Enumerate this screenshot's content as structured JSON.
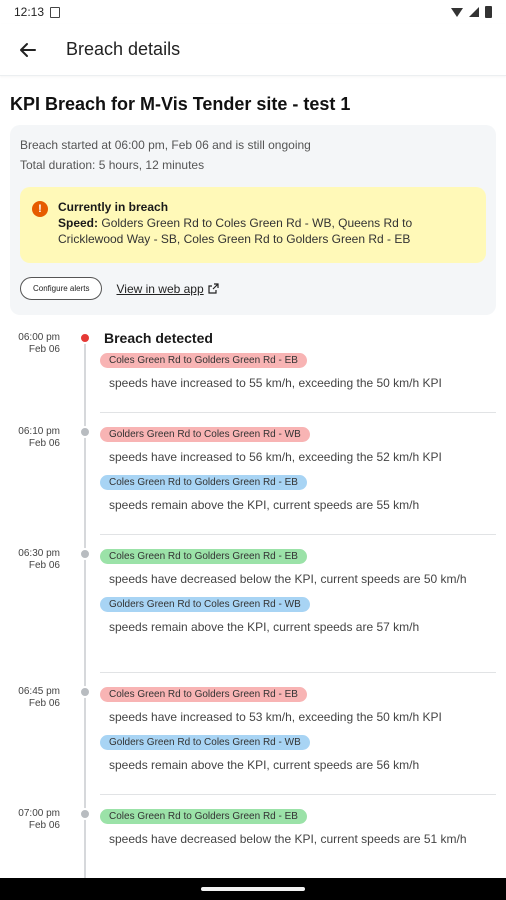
{
  "status_bar": {
    "time": "12:13"
  },
  "app_bar": {
    "title": "Breach details"
  },
  "page": {
    "title": "KPI Breach for M-Vis Tender site - test 1"
  },
  "summary": {
    "started": "Breach started at 06:00 pm, Feb 06 and is still ongoing",
    "duration": "Total duration: 5 hours, 12 minutes",
    "alert_title": "Currently in breach",
    "alert_prefix": "Speed:",
    "alert_text": "Golders Green Rd to Coles Green Rd - WB, Queens Rd to Cricklewood Way - SB, Coles Green Rd to Golders Green Rd - EB",
    "configure_label": "Configure alerts",
    "web_link_label": "View in web app"
  },
  "timeline": [
    {
      "time": "06:00 pm",
      "date": "Feb 06",
      "heading": "Breach detected",
      "dot": "red",
      "items": [
        {
          "chip": "Coles Green Rd to Golders Green Rd - EB",
          "chip_color": "red",
          "desc": "speeds have increased to 55 km/h, exceeding the 50 km/h KPI"
        }
      ]
    },
    {
      "time": "06:10 pm",
      "date": "Feb 06",
      "heading": "",
      "dot": "grey",
      "items": [
        {
          "chip": "Golders Green Rd to Coles Green Rd - WB",
          "chip_color": "red",
          "desc": "speeds have increased to 56 km/h, exceeding the 52 km/h KPI"
        },
        {
          "chip": "Coles Green Rd to Golders Green Rd - EB",
          "chip_color": "blue",
          "desc": "speeds remain above the KPI, current speeds are 55 km/h"
        }
      ]
    },
    {
      "time": "06:30 pm",
      "date": "Feb 06",
      "heading": "",
      "dot": "grey",
      "items": [
        {
          "chip": "Coles Green Rd to Golders Green Rd - EB",
          "chip_color": "green",
          "desc": "speeds have decreased below the KPI, current speeds are 50 km/h"
        },
        {
          "chip": "Golders Green Rd to Coles Green Rd - WB",
          "chip_color": "blue",
          "desc": "speeds remain above the KPI, current speeds are 57 km/h"
        }
      ]
    },
    {
      "time": "06:45 pm",
      "date": "Feb 06",
      "heading": "",
      "dot": "grey",
      "items": [
        {
          "chip": "Coles Green Rd to Golders Green Rd - EB",
          "chip_color": "red",
          "desc": "speeds have increased to 53 km/h, exceeding the 50 km/h KPI"
        },
        {
          "chip": "Golders Green Rd to Coles Green Rd - WB",
          "chip_color": "blue",
          "desc": "speeds remain above the KPI, current speeds are 56 km/h"
        }
      ]
    },
    {
      "time": "07:00 pm",
      "date": "Feb 06",
      "heading": "",
      "dot": "grey",
      "items": [
        {
          "chip": "Coles Green Rd to Golders Green Rd - EB",
          "chip_color": "green",
          "desc": "speeds have decreased below the KPI, current speeds are 51 km/h"
        }
      ]
    }
  ],
  "colors": {
    "alert_bg": "#fff9b8",
    "alert_icon": "#e65c00",
    "chip_red": "#f8b4b4",
    "chip_blue": "#a8d4f4",
    "chip_green": "#9be2a8",
    "dot_red": "#e53935"
  }
}
